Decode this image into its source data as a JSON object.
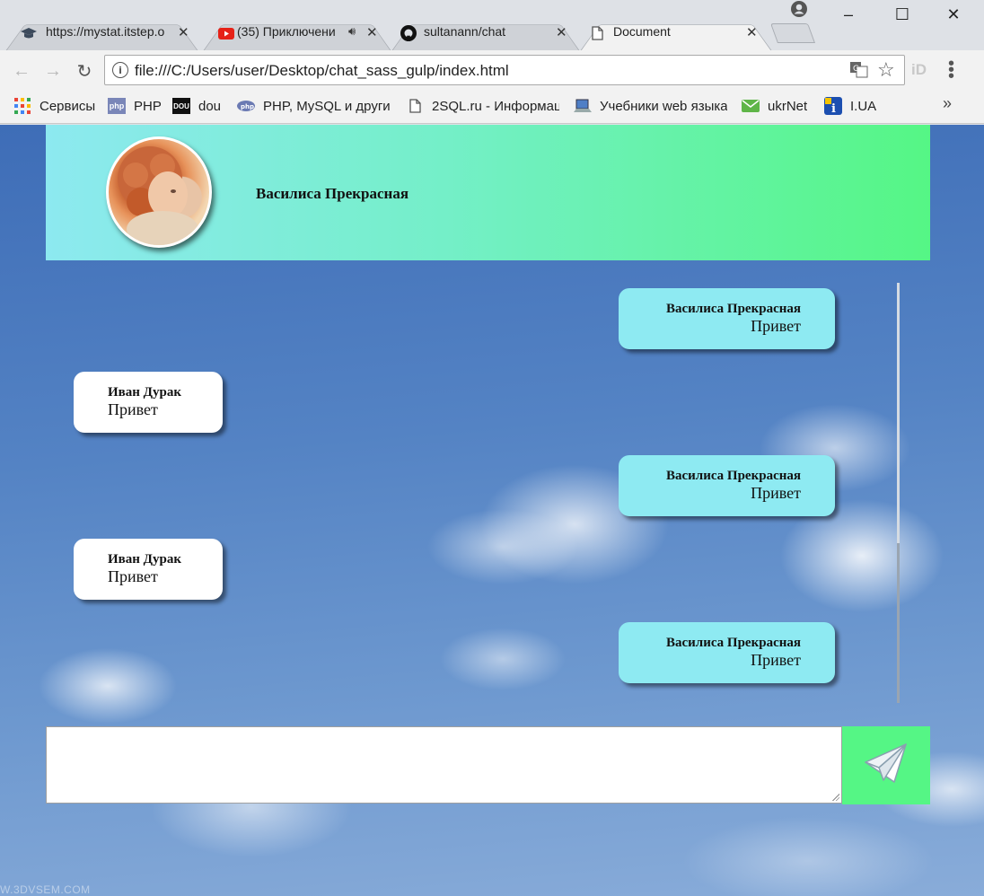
{
  "browser": {
    "tabs": [
      {
        "title": "https://mystat.itstep.o",
        "icon": "graduation-cap-icon"
      },
      {
        "title": "(35) Приключени",
        "icon": "youtube-icon",
        "audio": true
      },
      {
        "title": "sultanann/chat",
        "icon": "github-icon"
      },
      {
        "title": "Document",
        "icon": "document-icon",
        "active": true
      }
    ],
    "window_controls": {
      "minimize": "–",
      "maximize": "☐",
      "close": "✕"
    },
    "address": {
      "url": "file:///C:/Users/user/Desktop/chat_sass_gulp/index.html"
    },
    "bookmarks": [
      {
        "label": "Сервисы",
        "icon": "apps-grid-icon"
      },
      {
        "label": "PHP",
        "icon": "php-icon"
      },
      {
        "label": "dou",
        "icon": "dou-icon"
      },
      {
        "label": "PHP, MySQL и други",
        "icon": "php-elephant-icon"
      },
      {
        "label": "2SQL.ru - Информац",
        "icon": "document-icon"
      },
      {
        "label": "Учебники web языка",
        "icon": "laptop-icon"
      },
      {
        "label": "ukrNet",
        "icon": "mail-icon"
      },
      {
        "label": "I.UA",
        "icon": "info-icon"
      }
    ],
    "bookmarks_more": "»",
    "extension_label": "iD"
  },
  "chat": {
    "contact_name": "Василиса Прекрасная",
    "messages": [
      {
        "author": "Василиса Прекрасная",
        "text": "Привет",
        "side": "mine"
      },
      {
        "author": "Иван Дурак",
        "text": "Привет",
        "side": "theirs"
      },
      {
        "author": "Василиса Прекрасная",
        "text": "Привет",
        "side": "mine"
      },
      {
        "author": "Иван Дурак",
        "text": "Привет",
        "side": "theirs"
      },
      {
        "author": "Василиса Прекрасная",
        "text": "Привет",
        "side": "mine"
      }
    ],
    "input": {
      "value": "",
      "placeholder": ""
    },
    "send_icon": "paper-plane-icon"
  },
  "watermark": "W.3DVSEM.COM",
  "colors": {
    "header_gradient_start": "#8de9f0",
    "header_gradient_end": "#55f685",
    "my_message_bg": "#8eeaf2",
    "their_message_bg": "#ffffff",
    "send_button_bg": "#55f685"
  }
}
